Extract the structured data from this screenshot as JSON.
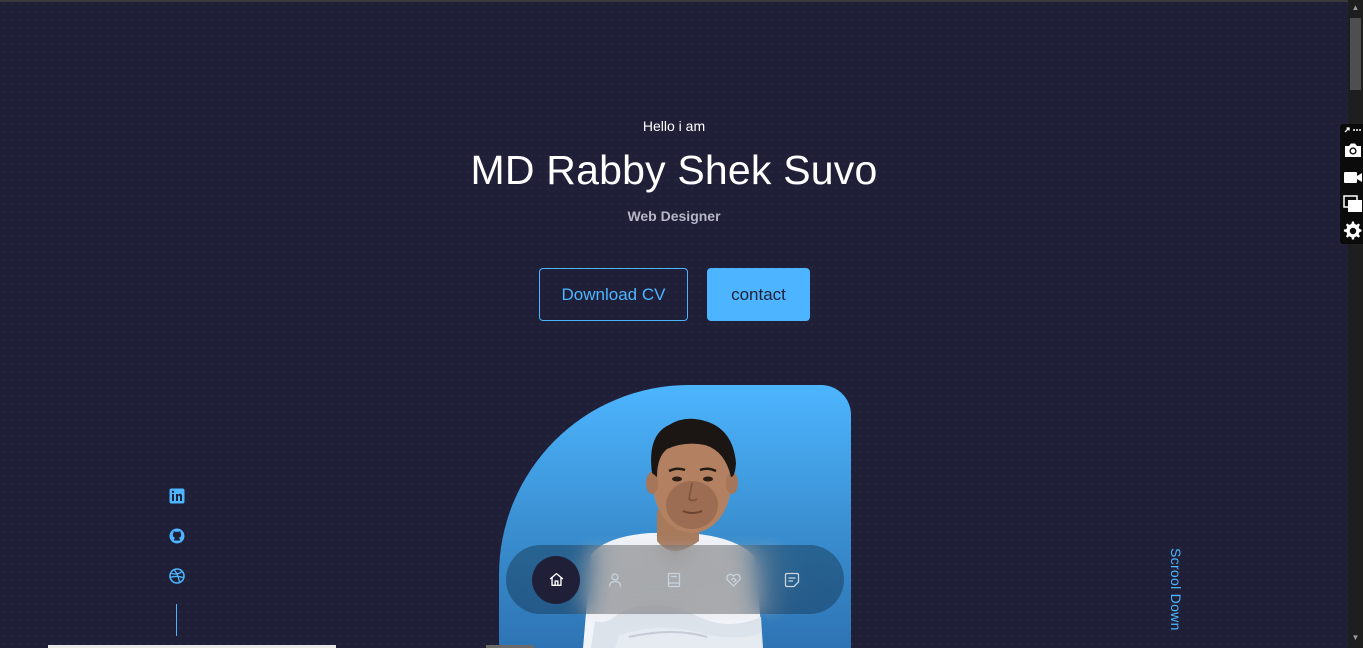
{
  "hero": {
    "greeting": "Hello i am",
    "name": "MD Rabby Shek Suvo",
    "role": "Web Designer"
  },
  "buttons": {
    "download_cv": "Download CV",
    "contact": "contact"
  },
  "socials": {
    "icons": [
      "linkedin-icon",
      "github-icon",
      "dribbble-icon"
    ]
  },
  "scroll_hint": "Scrool Down",
  "nav": {
    "items": [
      "home-icon",
      "user-icon",
      "book-icon",
      "services-icon",
      "message-icon"
    ],
    "active": "home-icon"
  },
  "colors": {
    "background": "#1f1f38",
    "primary": "#4db5ff",
    "text_light": "#b7b7c8"
  }
}
